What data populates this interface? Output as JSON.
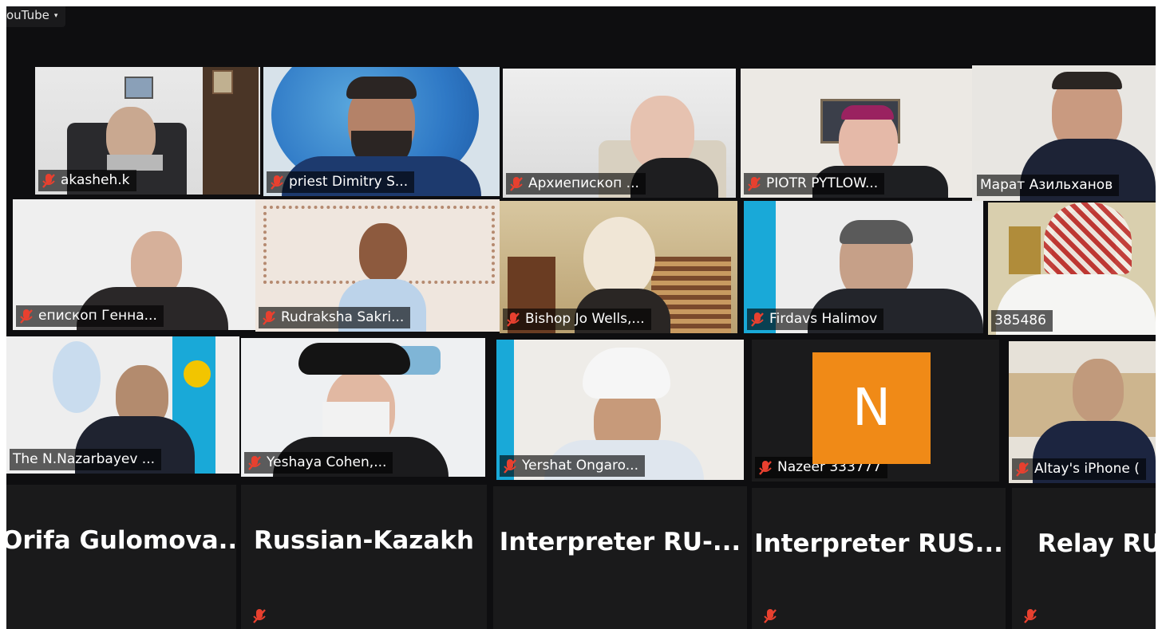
{
  "app": {
    "youtube_label": "ouTube",
    "youtube_caret": "▾"
  },
  "tiles": [
    {
      "name": "akasheh.k"
    },
    {
      "name": "priest Dimitry S..."
    },
    {
      "name": "Архиепископ ..."
    },
    {
      "name": "PIOTR PYTLOW..."
    },
    {
      "name": "Марат Азильханов",
      "active": true
    },
    {
      "name": "епископ Генна..."
    },
    {
      "name": "Rudraksha Sakri..."
    },
    {
      "name": "Bishop Jo Wells,..."
    },
    {
      "name": "Firdavs Halimov"
    },
    {
      "name": "385486"
    },
    {
      "name": "The N.Nazarbayev ..."
    },
    {
      "name": "Yeshaya Cohen,..."
    },
    {
      "name": "Yershat Ongaro..."
    },
    {
      "name": "Nazeer 333777",
      "avatar_letter": "N"
    },
    {
      "name": "Altay's iPhone ("
    }
  ],
  "audio_only": [
    {
      "name": "Orifa  Gulomova..."
    },
    {
      "name": "Russian-Kazakh"
    },
    {
      "name": "Interpreter  RU-..."
    },
    {
      "name": "Interpreter  RUS..."
    },
    {
      "name": "Relay RU"
    }
  ],
  "colors": {
    "mute": "#e8402f",
    "active_border": "#c7d93a",
    "avatar": "#f08a17"
  }
}
